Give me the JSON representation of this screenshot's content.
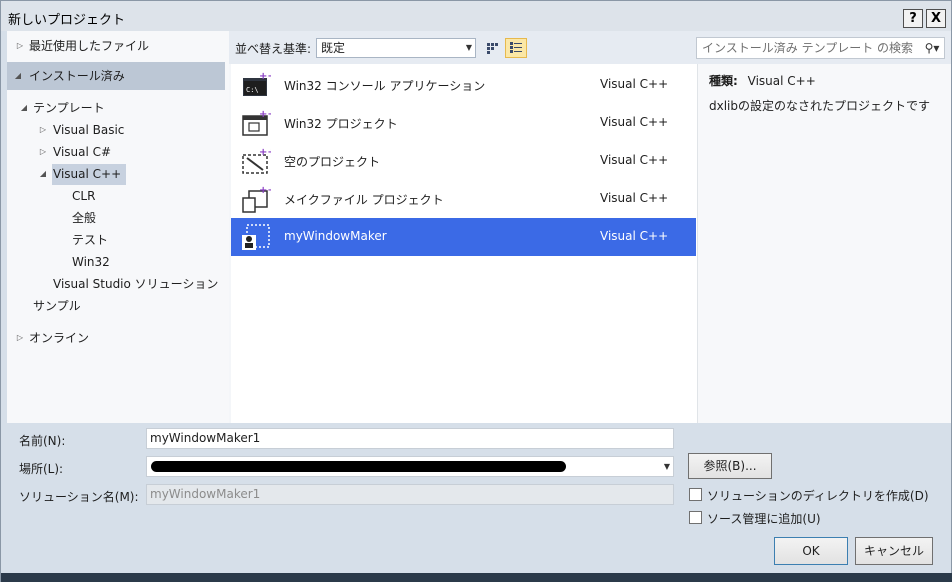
{
  "window": {
    "title": "新しいプロジェクト",
    "help_label": "?",
    "close_label": "X"
  },
  "sidebar": {
    "recent": "最近使用したファイル",
    "installed": "インストール済み",
    "templates": "テンプレート",
    "visual_basic": "Visual Basic",
    "visual_csharp": "Visual C#",
    "visual_cpp": "Visual C++",
    "cpp_children": [
      "CLR",
      "全般",
      "テスト",
      "Win32"
    ],
    "vs_solution": "Visual Studio ソリューション",
    "samples": "サンプル",
    "online": "オンライン"
  },
  "toolbar": {
    "sort_label": "並べ替え基準:",
    "sort_value": "既定",
    "search_placeholder": "インストール済み テンプレート の検索"
  },
  "templates": [
    {
      "name": "Win32 コンソール アプリケーション",
      "lang": "Visual C++",
      "icon": "console-app-icon",
      "selected": false
    },
    {
      "name": "Win32 プロジェクト",
      "lang": "Visual C++",
      "icon": "win32-project-icon",
      "selected": false
    },
    {
      "name": "空のプロジェクト",
      "lang": "Visual C++",
      "icon": "empty-project-icon",
      "selected": false
    },
    {
      "name": "メイクファイル プロジェクト",
      "lang": "Visual C++",
      "icon": "makefile-project-icon",
      "selected": false
    },
    {
      "name": "myWindowMaker",
      "lang": "Visual C++",
      "icon": "custom-template-icon",
      "selected": true
    }
  ],
  "details": {
    "type_label": "種類:",
    "type_value": "Visual C++",
    "description": "dxlibの設定のなされたプロジェクトです"
  },
  "form": {
    "name_label": "名前(N):",
    "name_value": "myWindowMaker1",
    "location_label": "場所(L):",
    "solution_label": "ソリューション名(M):",
    "solution_value": "myWindowMaker1",
    "browse_label": "参照(B)...",
    "create_dir_label": "ソリューションのディレクトリを作成(D)",
    "source_control_label": "ソース管理に追加(U)",
    "ok_label": "OK",
    "cancel_label": "キャンセル"
  },
  "colors": {
    "selection": "#3b6ae6",
    "accent_plus": "#8a3fc4"
  }
}
